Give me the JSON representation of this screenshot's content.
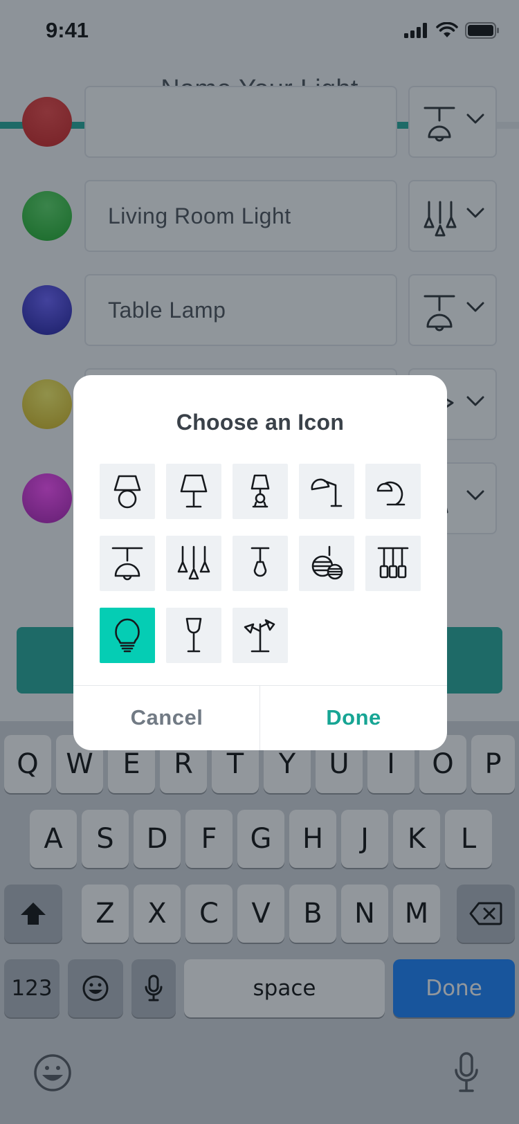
{
  "status_bar": {
    "time": "9:41"
  },
  "header": {
    "title": "Name Your Light",
    "progress": 0.83
  },
  "lights": [
    {
      "name": "",
      "dot_colors": [
        "#ee3a3a",
        "#c81414"
      ],
      "icon": "pendant-dome-icon"
    },
    {
      "name": "Living Room Light",
      "dot_colors": [
        "#4fd85c",
        "#0ea61b"
      ],
      "icon": "triple-cone-pendant-icon"
    },
    {
      "name": "Table Lamp",
      "dot_colors": [
        "#6055ff",
        "#12109a"
      ],
      "icon": "pendant-dome-icon"
    },
    {
      "name": "",
      "dot_colors": [
        "#fbf25c",
        "#cfb00e"
      ],
      "icon": "wall-light-icon"
    },
    {
      "name": "",
      "dot_colors": [
        "#ff3dff",
        "#a510b0"
      ],
      "icon": "pendant-icon"
    }
  ],
  "modal": {
    "title": "Choose an Icon",
    "icons": [
      "table-lamp-round-icon",
      "table-lamp-trapezoid-icon",
      "small-lamp-icon",
      "desk-lamp-icon",
      "arc-lamp-icon",
      "pendant-dome-icon",
      "triple-cone-pendant-icon",
      "single-pendant-icon",
      "globe-pendant-icon",
      "multi-pendant-bar-icon",
      "light-bulb-icon",
      "floor-lamp-icon",
      "double-spot-lamp-icon"
    ],
    "selected_index": 10,
    "cancel_label": "Cancel",
    "done_label": "Done"
  },
  "keyboard": {
    "row1": [
      "Q",
      "W",
      "E",
      "R",
      "T",
      "Y",
      "U",
      "I",
      "O",
      "P"
    ],
    "row2": [
      "A",
      "S",
      "D",
      "F",
      "G",
      "H",
      "J",
      "K",
      "L"
    ],
    "row3": [
      "Z",
      "X",
      "C",
      "V",
      "B",
      "N",
      "M"
    ],
    "numbers_label": "123",
    "space_label": "space",
    "return_label": "Done"
  },
  "colors": {
    "accent": "#17a594",
    "selected_tile": "#05cdb4",
    "keyboard_blue": "#0a7aff"
  }
}
